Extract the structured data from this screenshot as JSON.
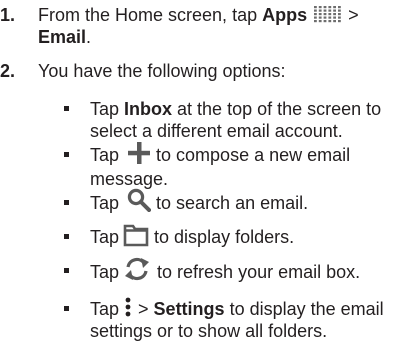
{
  "steps": [
    {
      "number": "1.",
      "text_before": "From the Home screen, tap ",
      "bold_apps": "Apps",
      "text_after_icon": " >",
      "bold_email": "Email",
      "text_end": "."
    },
    {
      "number": "2.",
      "text": "You have the following options:"
    }
  ],
  "options": [
    {
      "tap": "Tap ",
      "bold": "Inbox",
      "line1_rest": " at the top of the screen to",
      "line2": "select a different email account.",
      "icon": null
    },
    {
      "tap": "Tap",
      "icon": "plus-icon",
      "line1_rest": " to compose a new email",
      "line2": "message."
    },
    {
      "tap": "Tap",
      "icon": "search-icon",
      "line1_rest": " to search an email."
    },
    {
      "tap": "Tap",
      "icon": "folder-icon",
      "line1_rest": " to display folders."
    },
    {
      "tap": "Tap",
      "icon": "refresh-icon",
      "line1_rest": " to refresh your email box."
    },
    {
      "tap": "Tap",
      "icon": "menu-icon",
      "arrow": " > ",
      "bold": "Settings",
      "line1_rest": " to display the email",
      "line2": "settings or to show all folders."
    }
  ],
  "colors": {
    "text": "#231f20",
    "icon_gray": "#5a5a5a",
    "dots_gray": "#6d6d6d"
  }
}
